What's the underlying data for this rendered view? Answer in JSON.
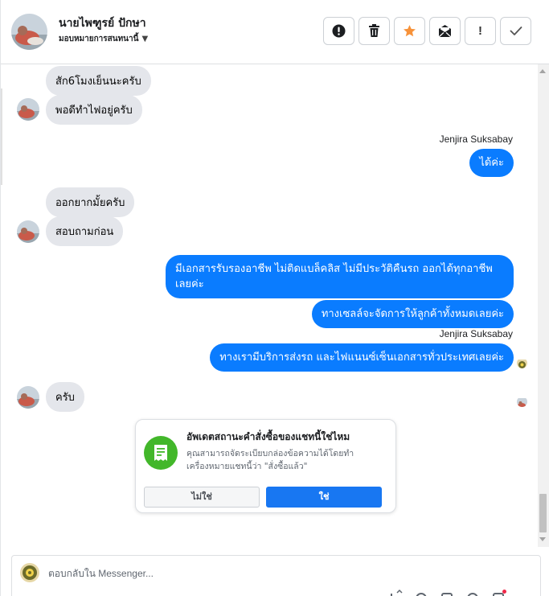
{
  "header": {
    "contact_name": "นายไพฑูรย์ ปักษา",
    "assign_label": "มอบหมายการสนทนานี้",
    "assign_caret_icon": "caret-down-icon",
    "toolbar": [
      {
        "name": "report-spam-button",
        "icon": "alert-circle-icon",
        "label": ""
      },
      {
        "name": "delete-button",
        "icon": "trash-icon",
        "label": ""
      },
      {
        "name": "star-button",
        "icon": "star-icon",
        "label": ""
      },
      {
        "name": "mark-unread-button",
        "icon": "envelope-open-icon",
        "label": ""
      },
      {
        "name": "mark-important-button",
        "icon": "exclamation-icon",
        "label": "!"
      },
      {
        "name": "mark-done-button",
        "icon": "check-icon",
        "label": ""
      }
    ]
  },
  "messages": {
    "m1": "สัก6โมงเย็นนะครับ",
    "m2": "พอดีทำไฟอยู่ครับ",
    "sender1": "Jenjira Suksabay",
    "m3": "ได้ค่ะ",
    "m4": "ออกยากมั้ยครับ",
    "m5": "สอบถามก่อน",
    "m6": "มีเอกสารรับรองอาชีพ ไม่ติดแบล็คลิส ไม่มีประวัติคืนรถ ออกได้ทุกอาชีพเลยค่ะ",
    "m7": "ทางเซลล์จะจัดการให้ลูกค้าทั้งหมดเลยค่ะ",
    "sender2": "Jenjira Suksabay",
    "m8": "ทางเรามีบริการส่งรถ และไฟแนนซ์เซ็นเอกสารทั่วประเทศเลยค่ะ",
    "m9": "ครับ"
  },
  "card": {
    "icon": "receipt-icon",
    "title": "อัพเดตสถานะคำสั่งซื้อของแชทนี้ใช่ไหม",
    "description": "คุณสามารถจัดระเบียบกล่องข้อความได้โดยทำเครื่องหมายแชทนี้ว่า \"สั่งซื้อแล้ว\"",
    "no_label": "ไม่ใช่",
    "yes_label": "ใช่"
  },
  "composer": {
    "placeholder": "ตอบกลับใน Messenger...",
    "value": "",
    "tools": [
      "add-icon",
      "attach-icon",
      "image-icon",
      "emoji-icon",
      "saved-reply-icon"
    ]
  },
  "colors": {
    "outgoing_bubble": "#0a7cff",
    "incoming_bubble": "#e4e6eb",
    "card_icon_bg": "#42b72a",
    "primary_button": "#1877f2",
    "star": "#f7923a"
  }
}
